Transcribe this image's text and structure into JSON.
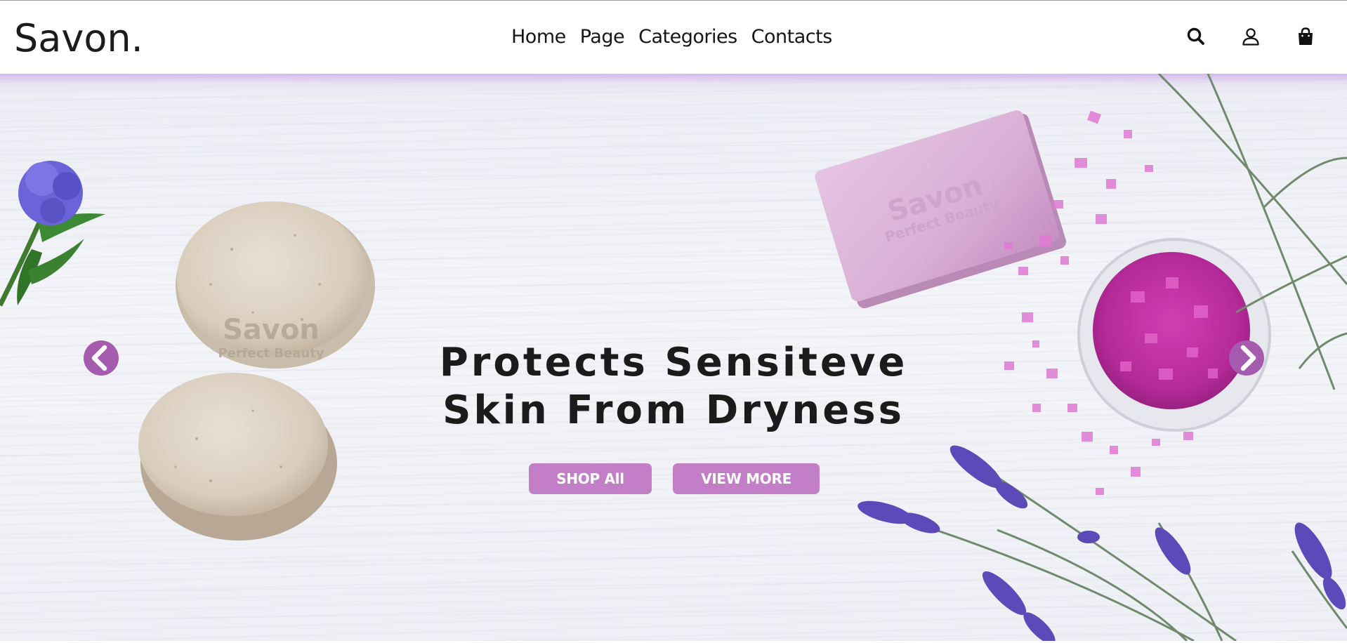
{
  "brand": {
    "logo": "Savon."
  },
  "nav": {
    "items": [
      "Home",
      "Page",
      "Categories",
      "Contacts"
    ]
  },
  "header_icons": [
    "search-icon",
    "user-icon",
    "shopping-bag-icon"
  ],
  "hero": {
    "headline_line1": "Protects Sensiteve",
    "headline_line2": "Skin From Dryness",
    "buttons": {
      "shop": "SHOP All",
      "view": "VIEW MORE"
    },
    "soap_stamp": {
      "brand": "Savon",
      "tagline": "Perfect Beauty"
    }
  },
  "colors": {
    "accent": "#c27fc8",
    "text": "#1b1b1b",
    "header_bg": "#ffffff"
  }
}
